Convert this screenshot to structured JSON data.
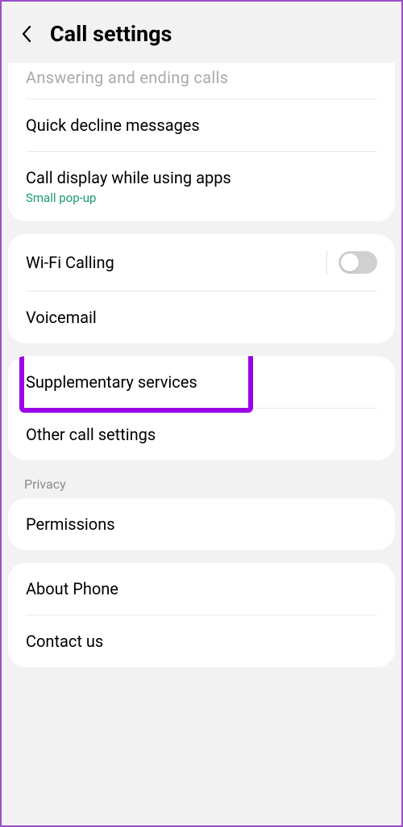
{
  "header": {
    "title": "Call settings"
  },
  "group1": {
    "cut_row": "Answering and ending calls",
    "quick_decline": "Quick decline messages",
    "call_display": "Call display while using apps",
    "call_display_sub": "Small pop-up"
  },
  "group2": {
    "wifi_calling": "Wi-Fi Calling",
    "voicemail": "Voicemail"
  },
  "group3": {
    "supplementary": "Supplementary services",
    "other_settings": "Other call settings"
  },
  "privacy_header": "Privacy",
  "group4": {
    "permissions": "Permissions"
  },
  "group5": {
    "about": "About Phone",
    "contact": "Contact us"
  },
  "colors": {
    "highlight": "#9b00e8",
    "accent_green": "#1a9d6e"
  }
}
